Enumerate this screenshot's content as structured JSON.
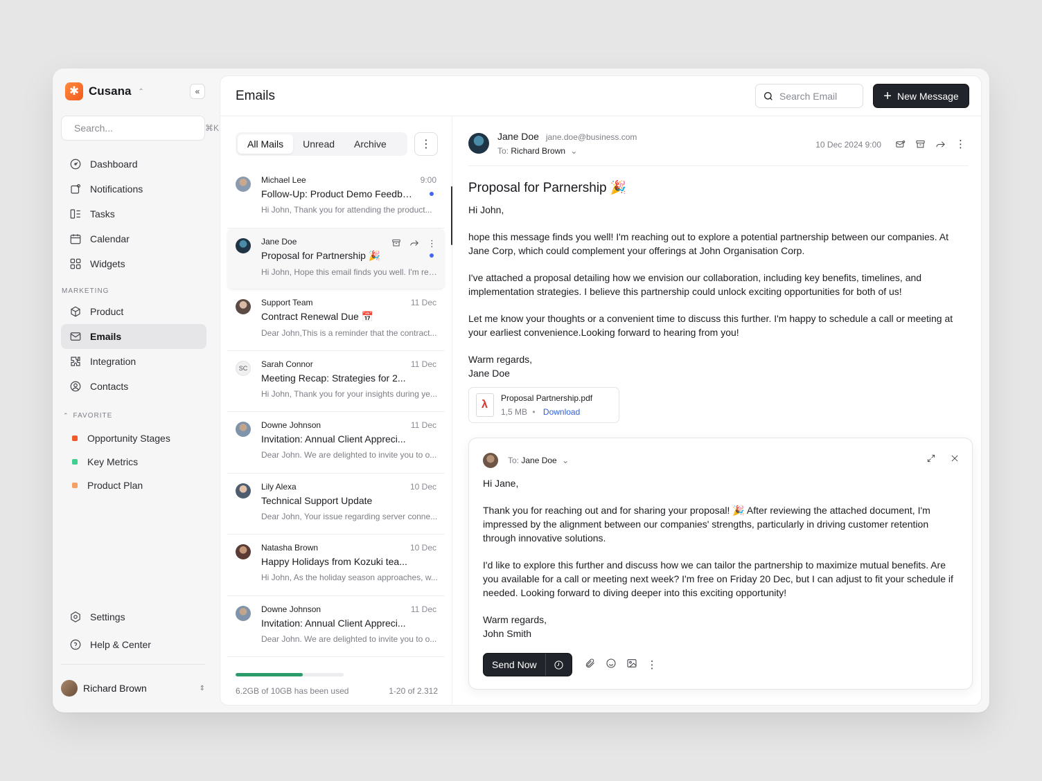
{
  "brand": {
    "name": "Cusana"
  },
  "sidebar": {
    "search_placeholder": "Search...",
    "search_shortcut": "⌘K",
    "items": [
      {
        "label": "Dashboard",
        "icon": "dashboard-icon"
      },
      {
        "label": "Notifications",
        "icon": "bell-icon"
      },
      {
        "label": "Tasks",
        "icon": "tasks-icon"
      },
      {
        "label": "Calendar",
        "icon": "calendar-icon"
      },
      {
        "label": "Widgets",
        "icon": "widgets-icon"
      }
    ],
    "marketing_label": "MARKETING",
    "marketing_items": [
      {
        "label": "Product",
        "icon": "box-icon"
      },
      {
        "label": "Emails",
        "icon": "mail-icon",
        "active": true
      },
      {
        "label": "Integration",
        "icon": "puzzle-icon"
      },
      {
        "label": "Contacts",
        "icon": "contact-icon"
      }
    ],
    "favorite_label": "FAVORITE",
    "favorites": [
      {
        "label": "Opportunity Stages",
        "color": "#f15a2b"
      },
      {
        "label": "Key Metrics",
        "color": "#3fcf8e"
      },
      {
        "label": "Product Plan",
        "color": "#f7a065"
      }
    ],
    "settings_label": "Settings",
    "help_label": "Help & Center",
    "user_name": "Richard Brown"
  },
  "header": {
    "title": "Emails",
    "search_placeholder": "Search Email",
    "new_message_label": "New Message"
  },
  "list": {
    "tabs": [
      "All Mails",
      "Unread",
      "Archive"
    ],
    "active_tab": "All Mails",
    "mails": [
      {
        "sender": "Michael Lee",
        "time": "9:00",
        "subject": "Follow-Up: Product Demo Feedba...",
        "preview": "Hi John, Thank you for attending the product...",
        "unread": true
      },
      {
        "sender": "Jane Doe",
        "time": "",
        "subject": "Proposal for Partnership 🎉",
        "preview": "Hi John, Hope this email finds you well. I'm rea...",
        "unread": true,
        "hover": true
      },
      {
        "sender": "Support Team",
        "time": "11 Dec",
        "subject": "Contract Renewal Due 📅",
        "preview": "Dear John,This is a reminder that the contract..."
      },
      {
        "sender": "Sarah Connor",
        "initials": "SC",
        "time": "11 Dec",
        "subject": "Meeting Recap: Strategies for 2...",
        "preview": "Hi John, Thank you for your insights during ye..."
      },
      {
        "sender": "Downe Johnson",
        "time": "11 Dec",
        "subject": "Invitation: Annual Client Appreci...",
        "preview": "Dear John. We are delighted to invite you to o..."
      },
      {
        "sender": "Lily Alexa",
        "time": "10 Dec",
        "subject": "Technical Support Update",
        "preview": "Dear John, Your issue regarding server conne..."
      },
      {
        "sender": "Natasha Brown",
        "time": "10 Dec",
        "subject": "Happy Holidays from Kozuki tea...",
        "preview": "Hi John, As the holiday season approaches, w..."
      },
      {
        "sender": "Downe Johnson",
        "time": "11 Dec",
        "subject": "Invitation: Annual Client Appreci...",
        "preview": "Dear John. We are delighted to invite you to o..."
      }
    ],
    "storage_text": "6.2GB of 10GB has been used",
    "storage_fraction": 0.62,
    "pagination": "1-20 of 2.312"
  },
  "reading": {
    "from_name": "Jane Doe",
    "from_email": "jane.doe@business.com",
    "to_label": "To:",
    "to_name": "Richard Brown",
    "date": "10 Dec 2024 9:00",
    "subject": "Proposal for Parnership 🎉",
    "greeting": "Hi John,",
    "paragraphs": [
      "hope this message finds you well! I'm reaching out to explore a potential partnership between our companies. At Jane Corp, which could complement your offerings at John Organisation Corp.",
      "I've attached a proposal detailing how we envision our collaboration, including key benefits, timelines, and implementation strategies. I believe this partnership could unlock exciting opportunities for both of us!",
      "Let me know your thoughts or a convenient time to discuss this further. I'm happy to schedule a call or meeting at your earliest convenience.Looking forward to hearing from you!"
    ],
    "signoff": "Warm regards,",
    "signature": "Jane Doe",
    "attachment": {
      "name": "Proposal Partnership.pdf",
      "size": "1,5 MB",
      "download_label": "Download"
    }
  },
  "reply": {
    "to_label": "To:",
    "to_name": "Jane Doe",
    "greeting": "Hi Jane,",
    "paragraphs": [
      "Thank you for reaching out and for sharing your proposal! 🎉 After reviewing the attached document, I'm impressed by the alignment between our companies' strengths, particularly in driving customer retention through innovative solutions.",
      "I'd like to explore this further and discuss how we can tailor the partnership to maximize mutual benefits. Are you available for a call or meeting next week? I'm free on Friday 20 Dec, but I can adjust to fit your schedule if needed. Looking forward to diving deeper into this exciting opportunity!"
    ],
    "signoff": "Warm regards,",
    "signature": "John Smith",
    "send_label": "Send Now"
  }
}
